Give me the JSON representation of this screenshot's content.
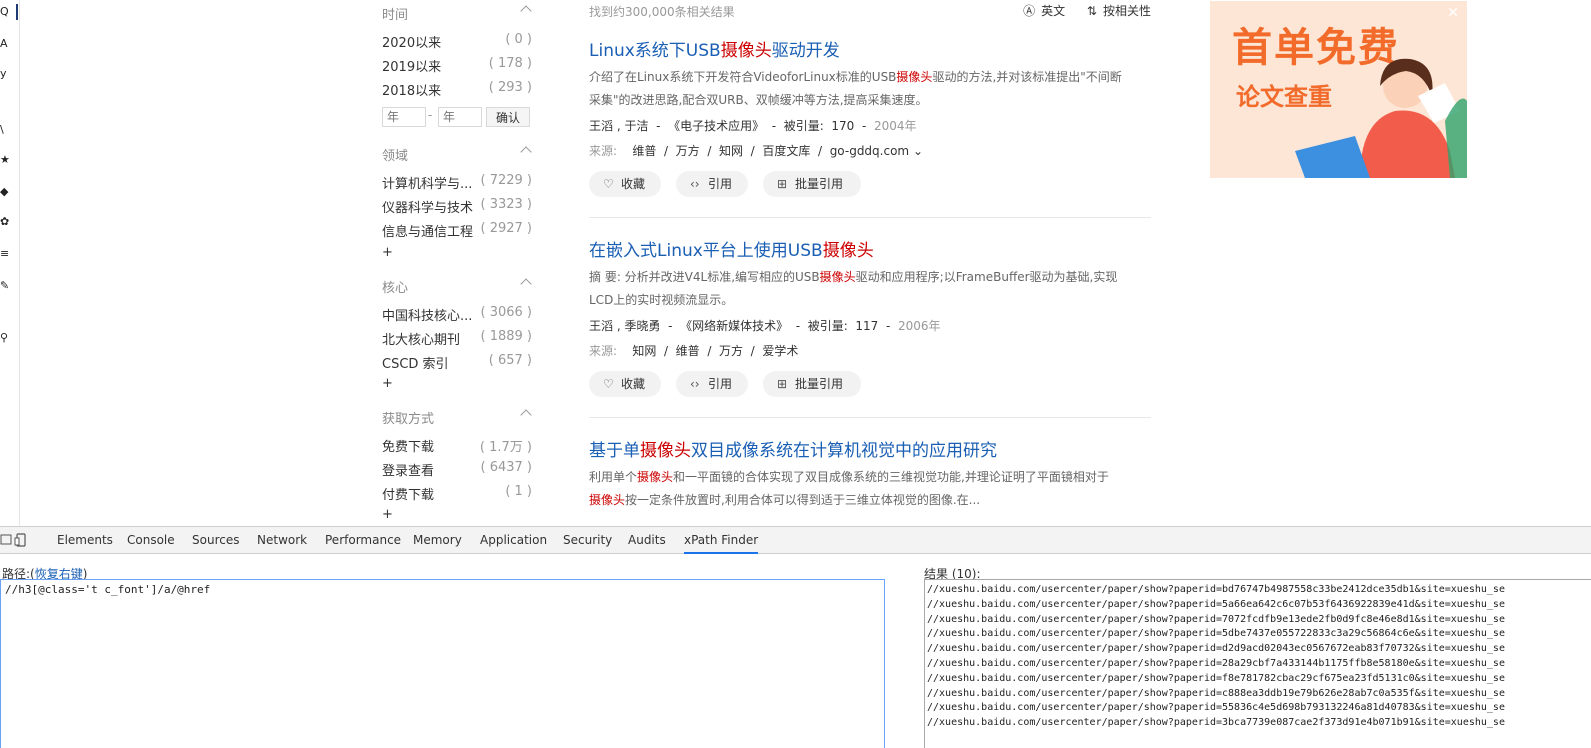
{
  "left_strip": {
    "glyphs": [
      "Q",
      "A",
      "y",
      "\\",
      "★",
      "◆",
      "✿",
      "≡",
      "✎",
      "⚲"
    ]
  },
  "filters": {
    "time": {
      "heading": "时间",
      "items": [
        {
          "label": "2020以来",
          "count": "( 0 )"
        },
        {
          "label": "2019以来",
          "count": "( 178 )"
        },
        {
          "label": "2018以来",
          "count": "( 293 )"
        }
      ],
      "year_from_placeholder": "年",
      "year_to_placeholder": "年",
      "dash": "-",
      "confirm_label": "确认"
    },
    "field": {
      "heading": "领域",
      "items": [
        {
          "label": "计算机科学与...",
          "count": "( 7229 )"
        },
        {
          "label": "仪器科学与技术",
          "count": "( 3323 )"
        },
        {
          "label": "信息与通信工程",
          "count": "( 2927 )"
        }
      ],
      "more": "+"
    },
    "core": {
      "heading": "核心",
      "items": [
        {
          "label": "中国科技核心...",
          "count": "( 3066 )"
        },
        {
          "label": "北大核心期刊",
          "count": "( 1889 )"
        },
        {
          "label": "CSCD 索引",
          "count": "( 657 )"
        }
      ],
      "more": "+"
    },
    "access": {
      "heading": "获取方式",
      "items": [
        {
          "label": "免费下载",
          "count": "( 1.7万 )"
        },
        {
          "label": "登录查看",
          "count": "( 6437 )"
        },
        {
          "label": "付费下载",
          "count": "( 1 )"
        }
      ],
      "more": "+"
    }
  },
  "results_header": {
    "count_text": "找到约300,000条相关结果",
    "english_label": "英文",
    "sort_label": "按相关性"
  },
  "results": [
    {
      "title_pre": "Linux系统下USB",
      "title_hl": "摄像头",
      "title_post": "驱动开发",
      "abs1_pre": "介绍了在Linux系统下开发符合VideoforLinux标准的USB",
      "abs1_hl": "摄像头",
      "abs1_post": "驱动的方法,并对该标准提出\"不间断",
      "abs2": "采集\"的改进思路,配合双URB、双帧缓冲等方法,提高采集速度。",
      "authors": "王滔 ,  于洁",
      "sep": "-",
      "journal": "《电子技术应用》",
      "cited_label": "被引量:",
      "cited": "170",
      "year": "2004年",
      "source_label": "来源:",
      "sources": [
        "维普",
        "万方",
        "知网",
        "百度文库",
        "go-gddq.com"
      ],
      "source_sep": "/",
      "expand": "⌄",
      "btn_collect": "收藏",
      "btn_cite": "引用",
      "btn_batch": "批量引用"
    },
    {
      "title_pre": "在嵌入式Linux平台上使用USB",
      "title_hl": "摄像头",
      "title_post": "",
      "abs1_pre": "摘    要: 分析并改进V4L标准,编写相应的USB",
      "abs1_hl": "摄像头",
      "abs1_post": "驱动和应用程序;以FrameBuffer驱动为基础,实现",
      "abs2": "LCD上的实时视频流显示。",
      "authors": "王滔 ,  季晓勇",
      "sep": "-",
      "journal": "《网络新媒体技术》",
      "cited_label": "被引量:",
      "cited": "117",
      "year": "2006年",
      "source_label": "来源:",
      "sources": [
        "知网",
        "维普",
        "万方",
        "爱学术"
      ],
      "source_sep": "/",
      "btn_collect": "收藏",
      "btn_cite": "引用",
      "btn_batch": "批量引用"
    },
    {
      "title_pre": "基于单",
      "title_hl": "摄像头",
      "title_post": "双目成像系统在计算机视觉中的应用研究",
      "abs1_pre": "利用单个",
      "abs1_hl": "摄像头",
      "abs1_post": "和一平面镜的合体实现了双目成像系统的三维视觉功能,并理论证明了平面镜相对于",
      "abs2_hl": "摄像头",
      "abs2": "按一定条件放置时,利用合体可以得到适于三维立体视觉的图像.在..."
    }
  ],
  "ad": {
    "headline": "首单免费",
    "subline": "论文查重",
    "close": "✕",
    "colors": {
      "bg": "#fde6d6",
      "text": "#f26b2a"
    }
  },
  "devtools": {
    "tabs": [
      "Elements",
      "Console",
      "Sources",
      "Network",
      "Performance",
      "Memory",
      "Application",
      "Security",
      "Audits",
      "xPath Finder"
    ],
    "active_tab": "xPath Finder",
    "path_label": "路径:(",
    "path_link": "恢复右键",
    "path_label_end": ")",
    "path_value": "//h3[@class='t c_font']/a/@href",
    "result_label": "结果 (10):",
    "result_lines": [
      "//xueshu.baidu.com/usercenter/paper/show?paperid=bd76747b4987558c33be2412dce35db1&site=xueshu_se",
      "//xueshu.baidu.com/usercenter/paper/show?paperid=5a66ea642c6c07b53f6436922839e41d&site=xueshu_se",
      "//xueshu.baidu.com/usercenter/paper/show?paperid=7072fcdfb9e13ede2fb0d9fc8e46e8d1&site=xueshu_se",
      "//xueshu.baidu.com/usercenter/paper/show?paperid=5dbe7437e055722833c3a29c56864c6e&site=xueshu_se",
      "//xueshu.baidu.com/usercenter/paper/show?paperid=d2d9acd02043ec0567672eab83f70732&site=xueshu_se",
      "//xueshu.baidu.com/usercenter/paper/show?paperid=28a29cbf7a433144b1175ffb8e58180e&site=xueshu_se",
      "//xueshu.baidu.com/usercenter/paper/show?paperid=f8e781782cbac29cf675ea23fd5131c0&site=xueshu_se",
      "//xueshu.baidu.com/usercenter/paper/show?paperid=c888ea3ddb19e79b626e28ab7c0a535f&site=xueshu_se",
      "//xueshu.baidu.com/usercenter/paper/show?paperid=55836c4e5d698b793132246a81d40783&site=xueshu_se",
      "//xueshu.baidu.com/usercenter/paper/show?paperid=3bca7739e087cae2f373d91e4b071b91&site=xueshu_se"
    ],
    "colors": {
      "active_underline": "#1a73e8",
      "input_border": "#6aa3f5"
    }
  },
  "colors": {
    "link": "#1a5fb4",
    "highlight": "#c00000"
  }
}
